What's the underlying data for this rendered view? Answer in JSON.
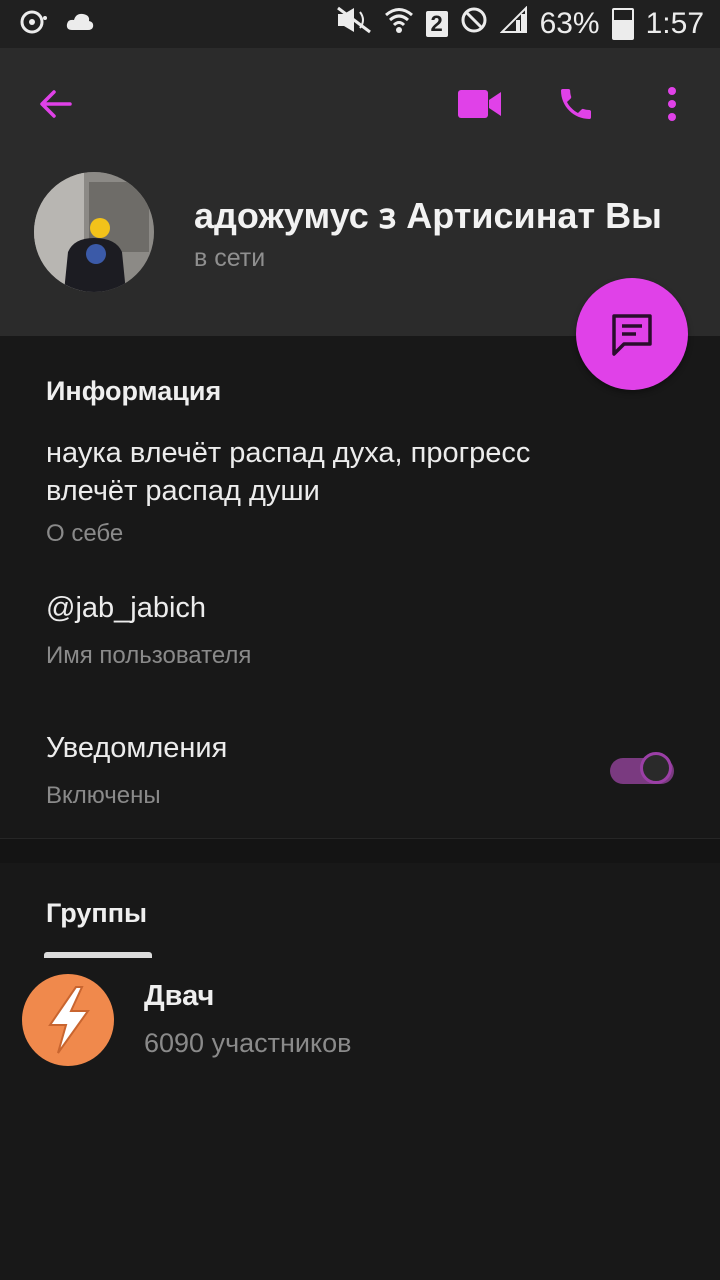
{
  "status_bar": {
    "battery": "63%",
    "time": "1:57",
    "sim_badge": "2"
  },
  "header": {
    "name": "адожумус 𐑂   Артисинат Вы",
    "status": "в сети"
  },
  "info": {
    "section_title": "Информация",
    "bio": "наука влечёт распад духа, прогресс влечёт распад души",
    "bio_caption": "О себе",
    "username": "@jab_jabich",
    "username_caption": "Имя пользователя",
    "notifications_label": "Уведомления",
    "notifications_state": "Включены",
    "notifications_enabled": true
  },
  "groups": {
    "section_title": "Группы",
    "items": [
      {
        "name": "Двач",
        "members": "6090 участников"
      }
    ]
  },
  "colors": {
    "accent": "#e041e8",
    "header_bg": "#2b2b2b",
    "body_bg": "#181818"
  },
  "icons": [
    "back-arrow-icon",
    "video-call-icon",
    "phone-icon",
    "more-vert-icon",
    "message-icon",
    "lightning-icon"
  ]
}
